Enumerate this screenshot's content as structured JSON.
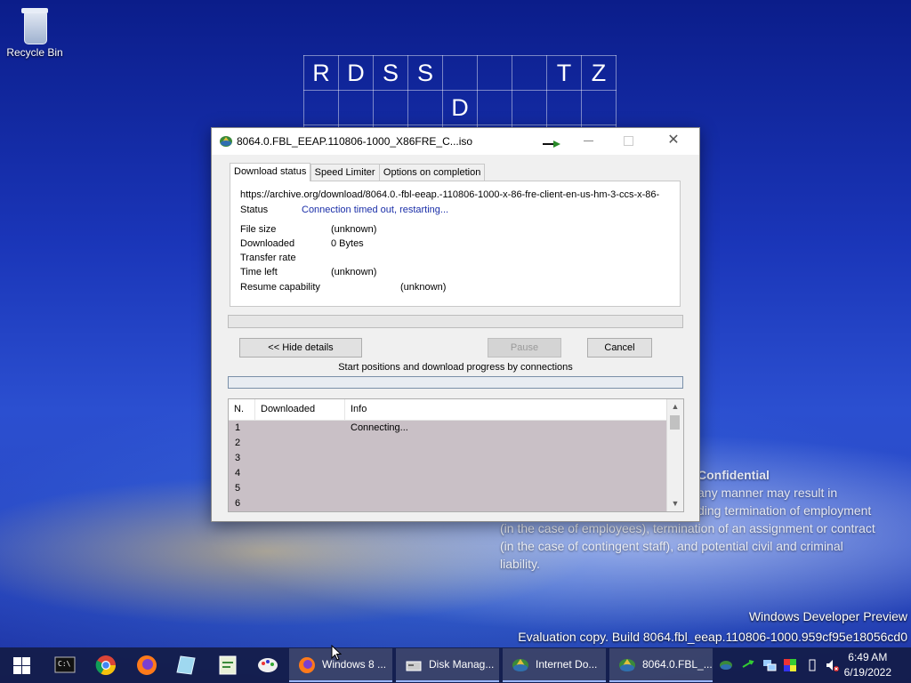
{
  "desktop": {
    "recycle_bin_label": "Recycle Bin",
    "grid_rows": [
      [
        "R",
        "D",
        "S",
        "S",
        "",
        "",
        "",
        "T",
        "Z"
      ],
      [
        "",
        "",
        "",
        "",
        "D",
        "",
        "",
        "",
        ""
      ],
      [
        "",
        "",
        "",
        "",
        "",
        "",
        "",
        "",
        ""
      ]
    ],
    "confidential": {
      "title": "Confidential",
      "lines": [
        "any manner may result in",
        "ding termination of employment",
        "(in the case of employees), termination of an assignment or contract",
        "(in the case of contingent staff), and potential civil and criminal",
        "liability."
      ]
    },
    "watermark_line1": "Windows Developer Preview",
    "watermark_line2": "Evaluation copy. Build 8064.fbl_eeap.110806-1000.959cf95e18056cd0"
  },
  "window": {
    "title": "8064.0.FBL_EEAP.110806-1000_X86FRE_C...iso",
    "close_glyph": "✕",
    "tabs": [
      "Download status",
      "Speed Limiter",
      "Options on completion"
    ],
    "url": "https://archive.org/download/8064.0.-fbl-eeap.-110806-1000-x-86-fre-client-en-us-hm-3-ccs-x-86-",
    "status_label": "Status",
    "status_value": "Connection timed out, restarting...",
    "details": [
      {
        "label": "File size",
        "value": "(unknown)"
      },
      {
        "label": "Downloaded",
        "value": "0 Bytes"
      },
      {
        "label": "Transfer rate",
        "value": ""
      },
      {
        "label": "Time left",
        "value": "(unknown)"
      },
      {
        "label": "Resume capability",
        "value": "(unknown)"
      }
    ],
    "buttons": {
      "hide_details": "<< Hide details",
      "pause": "Pause",
      "cancel": "Cancel"
    },
    "connections_label": "Start positions and download progress by connections",
    "table": {
      "columns": [
        "N.",
        "Downloaded",
        "Info"
      ],
      "rows": [
        {
          "n": "1",
          "downloaded": "",
          "info": "Connecting..."
        },
        {
          "n": "2",
          "downloaded": "",
          "info": ""
        },
        {
          "n": "3",
          "downloaded": "",
          "info": ""
        },
        {
          "n": "4",
          "downloaded": "",
          "info": ""
        },
        {
          "n": "5",
          "downloaded": "",
          "info": ""
        },
        {
          "n": "6",
          "downloaded": "",
          "info": ""
        }
      ]
    }
  },
  "taskbar": {
    "pinned_icons": [
      "terminal-icon",
      "chrome-icon",
      "firefox-icon",
      "notepad-icon",
      "registry-icon",
      "paint-icon"
    ],
    "buttons": [
      {
        "label": "Windows 8 ...",
        "icon": "firefox-icon"
      },
      {
        "label": "Disk Manag...",
        "icon": "disk-management-icon"
      },
      {
        "label": "Internet Do...",
        "icon": "idm-icon"
      },
      {
        "label": "8064.0.FBL_...",
        "icon": "idm-icon"
      }
    ],
    "time": "6:49 AM",
    "date": "6/19/2022"
  },
  "colors": {
    "status_blue": "#1a2ea8",
    "taskbar": "#141c48",
    "desktop_blue": "#1a35b8"
  }
}
